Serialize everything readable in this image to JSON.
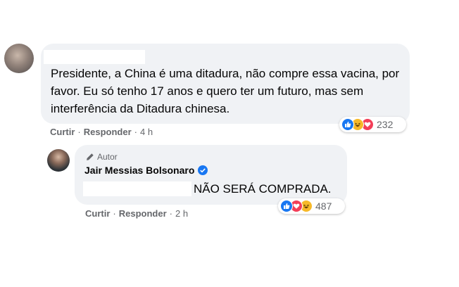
{
  "comment": {
    "text": "Presidente, a China é uma ditadura, não compre essa vacina, por favor. Eu só tenho 17 anos e quero ter um futuro, mas sem interferência da Ditadura chinesa.",
    "actions": {
      "like": "Curtir",
      "reply": "Responder",
      "time": "4 h"
    },
    "reactions": {
      "icons": [
        "like-icon",
        "haha-icon",
        "love-icon"
      ],
      "count": "232"
    }
  },
  "reply": {
    "badge": "Autor",
    "author": "Jair Messias Bolsonaro",
    "text": "NÃO SERÁ COMPRADA.",
    "actions": {
      "like": "Curtir",
      "reply": "Responder",
      "time": "2 h"
    },
    "reactions": {
      "icons": [
        "like-icon",
        "love-icon",
        "haha-icon"
      ],
      "count": "487"
    }
  },
  "colors": {
    "bubble": "#f0f2f5",
    "meta_text": "#65676b",
    "like_blue": "#1877f2",
    "love_red": "#f33e58",
    "haha_yellow": "#f7b928",
    "verified_blue": "#1877f2"
  }
}
